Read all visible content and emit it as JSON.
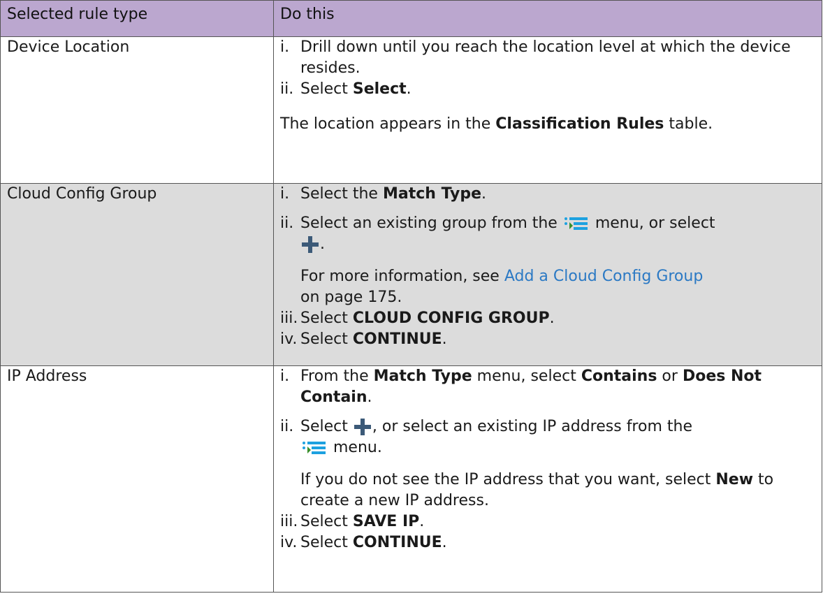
{
  "table": {
    "headers": [
      "Selected rule type",
      "Do this"
    ],
    "rows": [
      {
        "type": "Device Location",
        "steps": [
          {
            "num": "i.",
            "text": "Drill down until you reach the location level at which the device resides."
          },
          {
            "num": "ii.",
            "pre": "Select ",
            "bold": "Select",
            "post": "."
          }
        ],
        "note": {
          "pre": "The location appears in the ",
          "bold": "Classification Rules",
          "post": " table."
        }
      },
      {
        "type": "Cloud Config Group",
        "steps": [
          {
            "num": "i.",
            "pre": "Select the ",
            "bold": "Match Type",
            "post": "."
          },
          {
            "num": "ii.",
            "pre": "Select an existing group from the ",
            "mid": " menu, or select ",
            "post": "."
          },
          {
            "num": "iii.",
            "pre": "Select ",
            "bold": "CLOUD CONFIG GROUP",
            "post": "."
          },
          {
            "num": "iv.",
            "pre": "Select ",
            "bold": "CONTINUE",
            "post": "."
          }
        ],
        "sub": {
          "pre": "For more information, see ",
          "link": "Add a Cloud Config Group",
          "post": " on page 175."
        }
      },
      {
        "type": "IP Address",
        "steps": [
          {
            "num": "i.",
            "pre": "From the ",
            "bold1": "Match Type",
            "mid": " menu, select ",
            "bold2": "Contains",
            "or": " or ",
            "bold3": "Does Not Contain",
            "post": "."
          },
          {
            "num": "ii.",
            "pre": "Select ",
            "mid": ", or select an existing IP address from the ",
            "post": " menu."
          },
          {
            "num": "iii.",
            "pre": "Select ",
            "bold": "SAVE IP",
            "post": "."
          },
          {
            "num": "iv.",
            "pre": "Select ",
            "bold": "CONTINUE",
            "post": "."
          }
        ],
        "sub": {
          "pre": "If you do not see the IP address that you want, select ",
          "bold": "New",
          "post": " to create a new IP address."
        }
      }
    ]
  },
  "icons": {
    "menu": "list-menu-icon",
    "add": "plus-icon",
    "menu_color": "#1da1e0",
    "menu_bar_color": "#3a8f2c",
    "add_color": "#3c5a78"
  },
  "colors": {
    "header_bg": "#bba7cf",
    "shaded_row_bg": "#dcdcdc",
    "link": "#2b79c4"
  }
}
